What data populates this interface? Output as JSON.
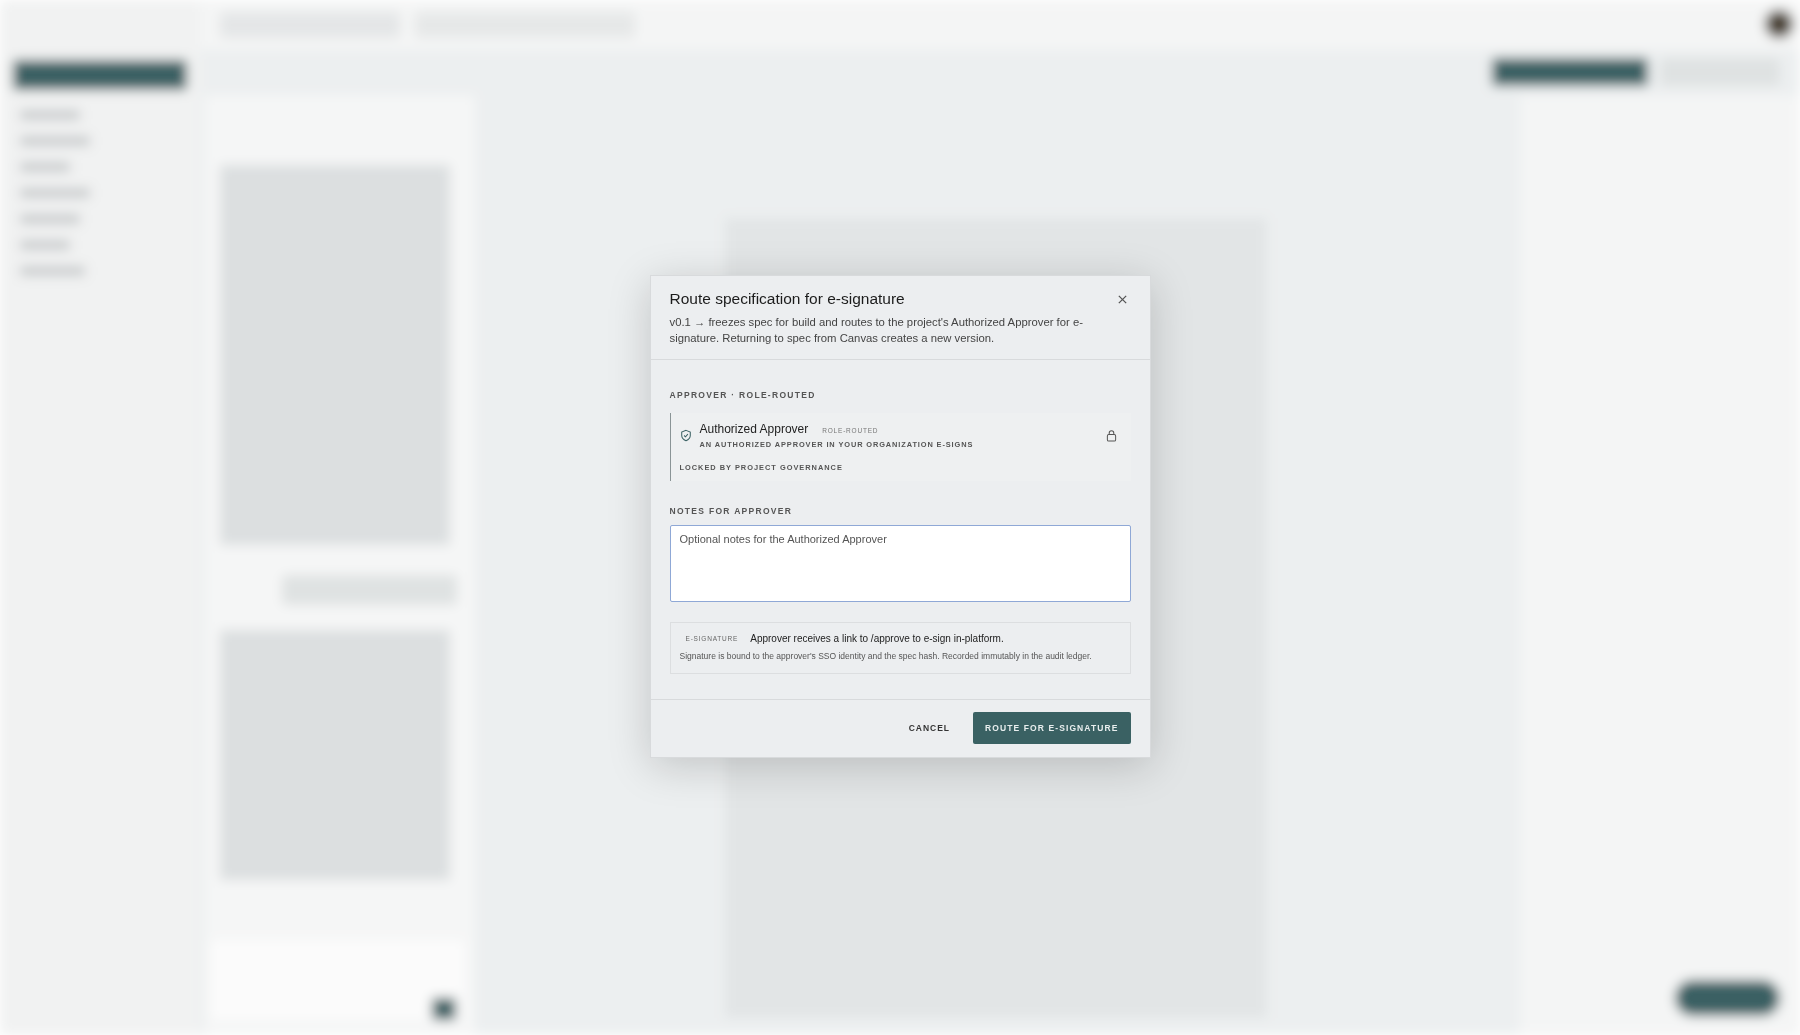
{
  "dialog": {
    "title": "Route specification for e-signature",
    "description": "v0.1 → freezes spec for build and routes to the project's Authorized Approver for e-signature. Returning to spec from Canvas creates a new version.",
    "approver_section": {
      "label": "APPROVER · ROLE-ROUTED",
      "name": "Authorized Approver",
      "badge": "ROLE-ROUTED",
      "subtitle": "AN AUTHORIZED APPROVER IN YOUR ORGANIZATION E-SIGNS",
      "note": "LOCKED BY PROJECT GOVERNANCE"
    },
    "notes": {
      "label": "NOTES FOR APPROVER",
      "placeholder": "Optional notes for the Authorized Approver"
    },
    "esignature": {
      "tag": "E-SIGNATURE",
      "headline": "Approver receives a link to /approve to e-sign in-platform.",
      "detail": "Signature is bound to the approver's SSO identity and the spec hash. Recorded immutably in the audit ledger."
    },
    "buttons": {
      "cancel": "CANCEL",
      "confirm": "ROUTE FOR E-SIGNATURE"
    }
  }
}
